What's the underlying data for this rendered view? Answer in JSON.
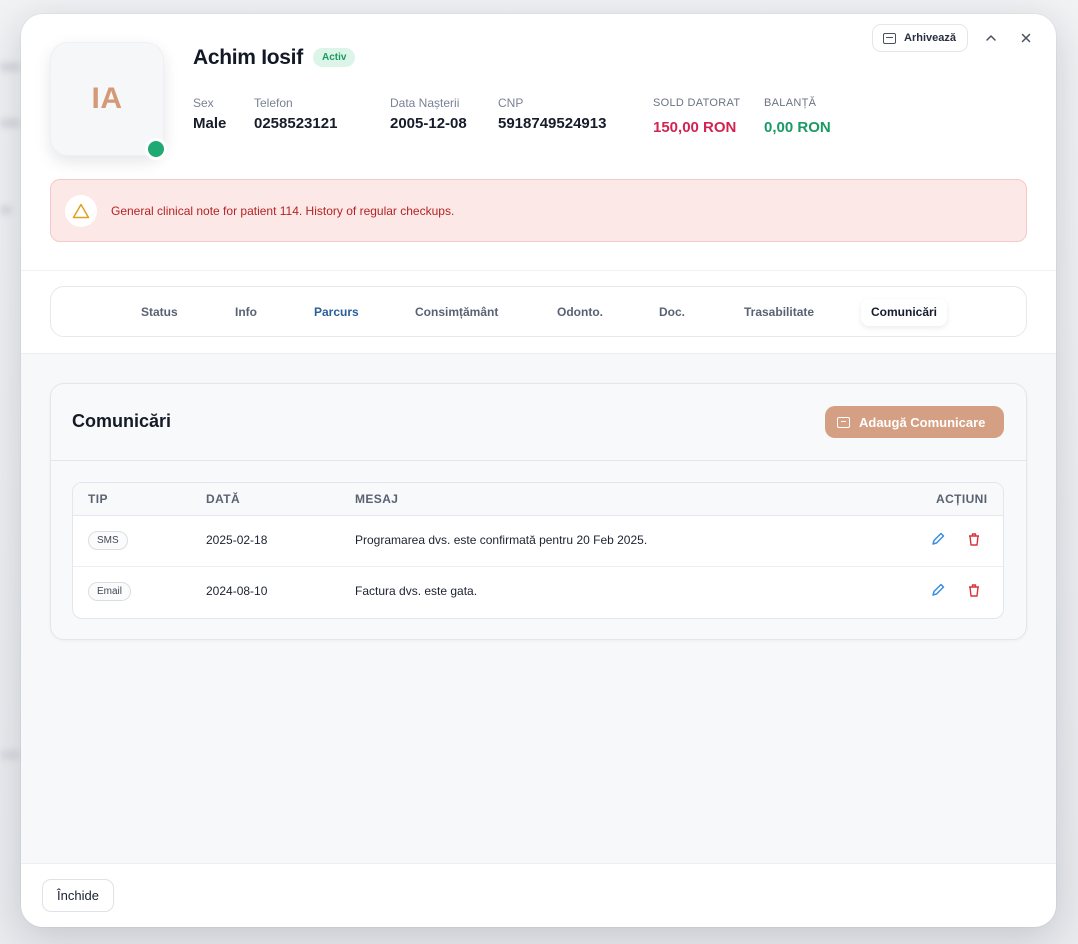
{
  "patient": {
    "initials": "IA",
    "name": "Achim Iosif",
    "status_badge": "Activ",
    "fields": {
      "sex_label": "Sex",
      "sex_value": "Male",
      "phone_label": "Telefon",
      "phone_value": "0258523121",
      "dob_label": "Data Nașterii",
      "dob_value": "2005-12-08",
      "cnp_label": "CNP",
      "cnp_value": "5918749524913"
    },
    "finance": {
      "owed_label": "SOLD DATORAT",
      "owed_value": "150,00 RON",
      "owed_color": "#d02552",
      "balance_label": "BALANȚĂ",
      "balance_value": "0,00 RON",
      "balance_color": "#1a9a63"
    }
  },
  "header_actions": {
    "archive_label": "Arhivează",
    "archive_icon": "archive-icon",
    "collapse_icon": "chevron-up-icon",
    "close_icon": "close-icon"
  },
  "alert": {
    "icon": "warning-triangle-icon",
    "text": "General clinical note for patient 114. History of regular checkups."
  },
  "tabs": [
    {
      "label": "Status"
    },
    {
      "label": "Info"
    },
    {
      "label": "Parcurs"
    },
    {
      "label": "Consimțământ"
    },
    {
      "label": "Odonto."
    },
    {
      "label": "Doc."
    },
    {
      "label": "Trasabilitate"
    },
    {
      "label": "Comunicări"
    }
  ],
  "active_tab": "Comunicări",
  "communications": {
    "title": "Comunicări",
    "add_button_label": "Adaugă Comunicare",
    "add_button_icon": "message-square-icon",
    "columns": [
      "TIP",
      "DATĂ",
      "MESAJ",
      "ACȚIUNI"
    ],
    "rows": [
      {
        "type": "SMS",
        "date": "2025-02-18",
        "message": "Programarea dvs. este confirmată pentru 20 Feb 2025."
      },
      {
        "type": "Email",
        "date": "2024-08-10",
        "message": "Factura dvs. este gata."
      }
    ],
    "row_actions": [
      "pencil-icon",
      "trash-icon"
    ]
  },
  "footer": {
    "close_label": "Închide"
  },
  "colors": {
    "accent": "#d49f82",
    "status_online": "#1eaa72",
    "alert_bg": "#fde8e8",
    "alert_text": "#b42323",
    "edit_icon": "#3b8ee0",
    "delete_icon": "#d8343c"
  }
}
